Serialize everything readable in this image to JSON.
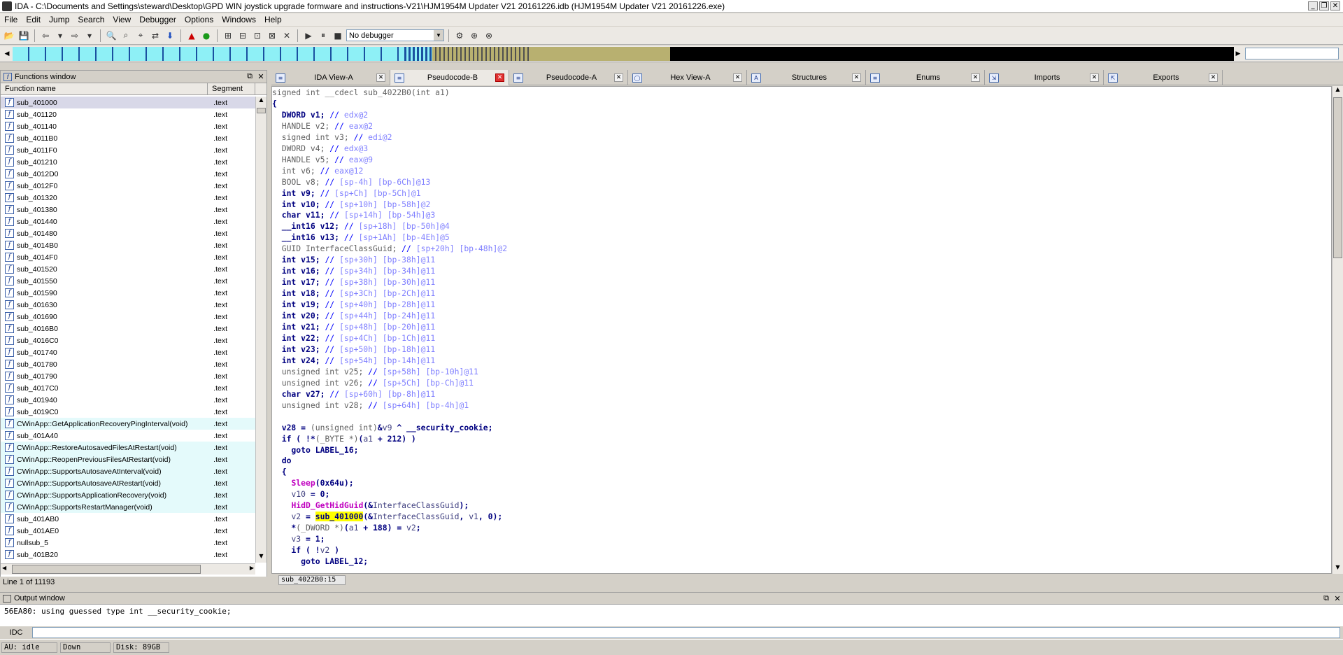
{
  "window": {
    "title": "IDA - C:\\Documents and Settings\\steward\\Desktop\\GPD  WIN joystick upgrade formware and instructions-V21\\HJM1954M Updater V21 20161226.idb (HJM1954M Updater V21 20161226.exe)"
  },
  "menu": [
    "File",
    "Edit",
    "Jump",
    "Search",
    "View",
    "Debugger",
    "Options",
    "Windows",
    "Help"
  ],
  "toolbar": {
    "debugger_select": "No debugger"
  },
  "functions_window": {
    "title": "Functions window",
    "col_name": "Function name",
    "col_segment": "Segment",
    "status": "Line 1 of 11193",
    "rows": [
      {
        "name": "sub_401000",
        "seg": ".text",
        "kind": "sel"
      },
      {
        "name": "sub_401120",
        "seg": ".text",
        "kind": ""
      },
      {
        "name": "sub_401140",
        "seg": ".text",
        "kind": ""
      },
      {
        "name": "sub_4011B0",
        "seg": ".text",
        "kind": ""
      },
      {
        "name": "sub_4011F0",
        "seg": ".text",
        "kind": ""
      },
      {
        "name": "sub_401210",
        "seg": ".text",
        "kind": ""
      },
      {
        "name": "sub_4012D0",
        "seg": ".text",
        "kind": ""
      },
      {
        "name": "sub_4012F0",
        "seg": ".text",
        "kind": ""
      },
      {
        "name": "sub_401320",
        "seg": ".text",
        "kind": ""
      },
      {
        "name": "sub_401380",
        "seg": ".text",
        "kind": ""
      },
      {
        "name": "sub_401440",
        "seg": ".text",
        "kind": ""
      },
      {
        "name": "sub_401480",
        "seg": ".text",
        "kind": ""
      },
      {
        "name": "sub_4014B0",
        "seg": ".text",
        "kind": ""
      },
      {
        "name": "sub_4014F0",
        "seg": ".text",
        "kind": ""
      },
      {
        "name": "sub_401520",
        "seg": ".text",
        "kind": ""
      },
      {
        "name": "sub_401550",
        "seg": ".text",
        "kind": ""
      },
      {
        "name": "sub_401590",
        "seg": ".text",
        "kind": ""
      },
      {
        "name": "sub_401630",
        "seg": ".text",
        "kind": ""
      },
      {
        "name": "sub_401690",
        "seg": ".text",
        "kind": ""
      },
      {
        "name": "sub_4016B0",
        "seg": ".text",
        "kind": ""
      },
      {
        "name": "sub_4016C0",
        "seg": ".text",
        "kind": ""
      },
      {
        "name": "sub_401740",
        "seg": ".text",
        "kind": ""
      },
      {
        "name": "sub_401780",
        "seg": ".text",
        "kind": ""
      },
      {
        "name": "sub_401790",
        "seg": ".text",
        "kind": ""
      },
      {
        "name": "sub_4017C0",
        "seg": ".text",
        "kind": ""
      },
      {
        "name": "sub_401940",
        "seg": ".text",
        "kind": ""
      },
      {
        "name": "sub_4019C0",
        "seg": ".text",
        "kind": ""
      },
      {
        "name": "CWinApp::GetApplicationRecoveryPingInterval(void)",
        "seg": ".text",
        "kind": "lib"
      },
      {
        "name": "sub_401A40",
        "seg": ".text",
        "kind": ""
      },
      {
        "name": "CWinApp::RestoreAutosavedFilesAtRestart(void)",
        "seg": ".text",
        "kind": "lib"
      },
      {
        "name": "CWinApp::ReopenPreviousFilesAtRestart(void)",
        "seg": ".text",
        "kind": "lib"
      },
      {
        "name": "CWinApp::SupportsAutosaveAtInterval(void)",
        "seg": ".text",
        "kind": "lib"
      },
      {
        "name": "CWinApp::SupportsAutosaveAtRestart(void)",
        "seg": ".text",
        "kind": "lib"
      },
      {
        "name": "CWinApp::SupportsApplicationRecovery(void)",
        "seg": ".text",
        "kind": "lib"
      },
      {
        "name": "CWinApp::SupportsRestartManager(void)",
        "seg": ".text",
        "kind": "lib"
      },
      {
        "name": "sub_401AB0",
        "seg": ".text",
        "kind": ""
      },
      {
        "name": "sub_401AE0",
        "seg": ".text",
        "kind": ""
      },
      {
        "name": "nullsub_5",
        "seg": ".text",
        "kind": ""
      },
      {
        "name": "sub_401B20",
        "seg": ".text",
        "kind": ""
      }
    ]
  },
  "tabs": [
    {
      "label": "IDA View-A",
      "icon": "ida-view-icon",
      "active": false
    },
    {
      "label": "Pseudocode-B",
      "icon": "pseudocode-icon",
      "active": true
    },
    {
      "label": "Pseudocode-A",
      "icon": "pseudocode-icon",
      "active": false
    },
    {
      "label": "Hex View-A",
      "icon": "hex-view-icon",
      "active": false
    },
    {
      "label": "Structures",
      "icon": "structures-icon",
      "active": false
    },
    {
      "label": "Enums",
      "icon": "enums-icon",
      "active": false
    },
    {
      "label": "Imports",
      "icon": "imports-icon",
      "active": false
    },
    {
      "label": "Exports",
      "icon": "exports-icon",
      "active": false
    }
  ],
  "code": {
    "lines": [
      [
        [
          "gr",
          "signed int __cdecl sub_4022B0(int a1)"
        ]
      ],
      [
        [
          "kw",
          "{"
        ]
      ],
      [
        [
          "kw",
          "  DWORD v1; "
        ],
        [
          "cm",
          "// "
        ],
        [
          "cm2",
          "edx@2"
        ]
      ],
      [
        [
          "gr",
          "  HANDLE v2; "
        ],
        [
          "cm",
          "// "
        ],
        [
          "cm2",
          "eax@2"
        ]
      ],
      [
        [
          "gr",
          "  signed int v3; "
        ],
        [
          "cm",
          "// "
        ],
        [
          "cm2",
          "edi@2"
        ]
      ],
      [
        [
          "gr",
          "  DWORD v4; "
        ],
        [
          "cm",
          "// "
        ],
        [
          "cm2",
          "edx@3"
        ]
      ],
      [
        [
          "gr",
          "  HANDLE v5; "
        ],
        [
          "cm",
          "// "
        ],
        [
          "cm2",
          "eax@9"
        ]
      ],
      [
        [
          "gr",
          "  int v6; "
        ],
        [
          "cm",
          "// "
        ],
        [
          "cm2",
          "eax@12"
        ]
      ],
      [
        [
          "gr",
          "  BOOL v8; "
        ],
        [
          "cm",
          "// "
        ],
        [
          "cm2",
          "[sp-4h] [bp-6Ch]@13"
        ]
      ],
      [
        [
          "kw",
          "  int v9; "
        ],
        [
          "cm",
          "// "
        ],
        [
          "cm2",
          "[sp+Ch] [bp-5Ch]@1"
        ]
      ],
      [
        [
          "kw",
          "  int v10; "
        ],
        [
          "cm",
          "// "
        ],
        [
          "cm2",
          "[sp+10h] [bp-58h]@2"
        ]
      ],
      [
        [
          "kw",
          "  char v11; "
        ],
        [
          "cm",
          "// "
        ],
        [
          "cm2",
          "[sp+14h] [bp-54h]@3"
        ]
      ],
      [
        [
          "kw",
          "  __int16 v12; "
        ],
        [
          "cm",
          "// "
        ],
        [
          "cm2",
          "[sp+18h] [bp-50h]@4"
        ]
      ],
      [
        [
          "kw",
          "  __int16 v13; "
        ],
        [
          "cm",
          "// "
        ],
        [
          "cm2",
          "[sp+1Ah] [bp-4Eh]@5"
        ]
      ],
      [
        [
          "gr",
          "  GUID InterfaceClassGuid; "
        ],
        [
          "cm",
          "// "
        ],
        [
          "cm2",
          "[sp+20h] [bp-48h]@2"
        ]
      ],
      [
        [
          "kw",
          "  int v15; "
        ],
        [
          "cm",
          "// "
        ],
        [
          "cm2",
          "[sp+30h] [bp-38h]@11"
        ]
      ],
      [
        [
          "kw",
          "  int v16; "
        ],
        [
          "cm",
          "// "
        ],
        [
          "cm2",
          "[sp+34h] [bp-34h]@11"
        ]
      ],
      [
        [
          "kw",
          "  int v17; "
        ],
        [
          "cm",
          "// "
        ],
        [
          "cm2",
          "[sp+38h] [bp-30h]@11"
        ]
      ],
      [
        [
          "kw",
          "  int v18; "
        ],
        [
          "cm",
          "// "
        ],
        [
          "cm2",
          "[sp+3Ch] [bp-2Ch]@11"
        ]
      ],
      [
        [
          "kw",
          "  int v19; "
        ],
        [
          "cm",
          "// "
        ],
        [
          "cm2",
          "[sp+40h] [bp-28h]@11"
        ]
      ],
      [
        [
          "kw",
          "  int v20; "
        ],
        [
          "cm",
          "// "
        ],
        [
          "cm2",
          "[sp+44h] [bp-24h]@11"
        ]
      ],
      [
        [
          "kw",
          "  int v21; "
        ],
        [
          "cm",
          "// "
        ],
        [
          "cm2",
          "[sp+48h] [bp-20h]@11"
        ]
      ],
      [
        [
          "kw",
          "  int v22; "
        ],
        [
          "cm",
          "// "
        ],
        [
          "cm2",
          "[sp+4Ch] [bp-1Ch]@11"
        ]
      ],
      [
        [
          "kw",
          "  int v23; "
        ],
        [
          "cm",
          "// "
        ],
        [
          "cm2",
          "[sp+50h] [bp-18h]@11"
        ]
      ],
      [
        [
          "kw",
          "  int v24; "
        ],
        [
          "cm",
          "// "
        ],
        [
          "cm2",
          "[sp+54h] [bp-14h]@11"
        ]
      ],
      [
        [
          "gr",
          "  unsigned int v25; "
        ],
        [
          "cm",
          "// "
        ],
        [
          "cm2",
          "[sp+58h] [bp-10h]@11"
        ]
      ],
      [
        [
          "gr",
          "  unsigned int v26; "
        ],
        [
          "cm",
          "// "
        ],
        [
          "cm2",
          "[sp+5Ch] [bp-Ch]@11"
        ]
      ],
      [
        [
          "kw",
          "  char v27; "
        ],
        [
          "cm",
          "// "
        ],
        [
          "cm2",
          "[sp+60h] [bp-8h]@11"
        ]
      ],
      [
        [
          "gr",
          "  unsigned int v28; "
        ],
        [
          "cm",
          "// "
        ],
        [
          "cm2",
          "[sp+64h] [bp-4h]@1"
        ]
      ],
      [
        [
          "gr",
          ""
        ]
      ],
      [
        [
          "kw",
          "  v28 = "
        ],
        [
          "gr",
          "(unsigned int)"
        ],
        [
          "kw",
          "&"
        ],
        [
          "id",
          "v9"
        ],
        [
          "kw",
          " ^ __security_cookie;"
        ]
      ],
      [
        [
          "kw",
          "  if ( !*"
        ],
        [
          "gr",
          "(_BYTE *)"
        ],
        [
          "kw",
          "("
        ],
        [
          "id",
          "a1"
        ],
        [
          "kw",
          " + 212) )"
        ]
      ],
      [
        [
          "kw",
          "    goto LABEL_16;"
        ]
      ],
      [
        [
          "kw",
          "  do"
        ]
      ],
      [
        [
          "kw",
          "  {"
        ]
      ],
      [
        [
          "kw",
          "    "
        ],
        [
          "fn",
          "Sleep"
        ],
        [
          "kw",
          "(0x64u);"
        ]
      ],
      [
        [
          "kw",
          "    "
        ],
        [
          "id",
          "v10"
        ],
        [
          "kw",
          " = 0;"
        ]
      ],
      [
        [
          "kw",
          "    "
        ],
        [
          "fn",
          "HidD_GetHidGuid"
        ],
        [
          "kw",
          "(&"
        ],
        [
          "id",
          "InterfaceClassGuid"
        ],
        [
          "kw",
          ");"
        ]
      ],
      [
        [
          "kw",
          "    "
        ],
        [
          "id",
          "v2"
        ],
        [
          "kw",
          " = "
        ],
        [
          "sub",
          "sub_401000"
        ],
        [
          "kw",
          "(&"
        ],
        [
          "id",
          "InterfaceClassGuid"
        ],
        [
          "kw",
          ", "
        ],
        [
          "id",
          "v1"
        ],
        [
          "kw",
          ", 0);"
        ]
      ],
      [
        [
          "kw",
          "    *"
        ],
        [
          "gr",
          "(_DWORD *)"
        ],
        [
          "kw",
          "("
        ],
        [
          "id",
          "a1"
        ],
        [
          "kw",
          " + 188) = "
        ],
        [
          "id",
          "v2"
        ],
        [
          "kw",
          ";"
        ]
      ],
      [
        [
          "kw",
          "    "
        ],
        [
          "id",
          "v3"
        ],
        [
          "kw",
          " = 1;"
        ]
      ],
      [
        [
          "kw",
          "    if ( !"
        ],
        [
          "id",
          "v2"
        ],
        [
          "kw",
          " )"
        ]
      ],
      [
        [
          "kw",
          "      goto LABEL_12;"
        ]
      ]
    ],
    "status": "sub_4022B0:15"
  },
  "output_window": {
    "title": "Output window",
    "line": "56EA80: using guessed type int __security_cookie;"
  },
  "idc": {
    "label": "IDC"
  },
  "statusbar": {
    "au": "AU:  idle",
    "dir": "Down",
    "disk": "Disk: 89GB"
  }
}
